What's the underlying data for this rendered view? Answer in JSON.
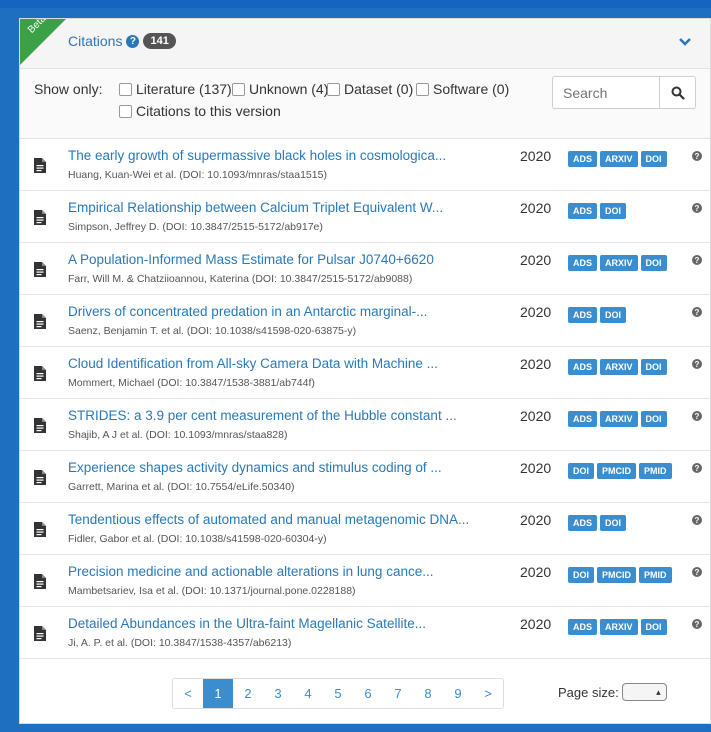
{
  "header": {
    "beta_label": "Beta",
    "title": "Citations",
    "help_icon": "question-circle-icon",
    "count": "141",
    "collapse_icon": "chevron-down-icon"
  },
  "filters": {
    "show_only_label": "Show only:",
    "options": [
      {
        "label": "Literature (137)",
        "checked": false
      },
      {
        "label": "Unknown (4)",
        "checked": false
      },
      {
        "label": "Dataset (0)",
        "checked": false
      },
      {
        "label": "Software (0)",
        "checked": false
      },
      {
        "label": "Citations to this version",
        "checked": false
      }
    ],
    "search_placeholder": "Search",
    "search_icon": "search-icon"
  },
  "rows": [
    {
      "title": "The early growth of supermassive black holes in cosmologica...",
      "subtitle": "Huang, Kuan-Wei et al. (DOI: 10.1093/mnras/staa1515)",
      "year": "2020",
      "badges": [
        "ADS",
        "ARXIV",
        "DOI"
      ]
    },
    {
      "title": "Empirical Relationship between Calcium Triplet Equivalent W...",
      "subtitle": "Simpson, Jeffrey D. (DOI: 10.3847/2515-5172/ab917e)",
      "year": "2020",
      "badges": [
        "ADS",
        "DOI"
      ]
    },
    {
      "title": "A Population-Informed Mass Estimate for Pulsar J0740+6620",
      "subtitle": "Farr, Will M. & Chatziioannou, Katerina (DOI: 10.3847/2515-5172/ab9088)",
      "year": "2020",
      "badges": [
        "ADS",
        "ARXIV",
        "DOI"
      ]
    },
    {
      "title": "Drivers of concentrated predation in an Antarctic marginal-...",
      "subtitle": "Saenz, Benjamin T. et al. (DOI: 10.1038/s41598-020-63875-y)",
      "year": "2020",
      "badges": [
        "ADS",
        "DOI"
      ]
    },
    {
      "title": "Cloud Identification from All-sky Camera Data with Machine ...",
      "subtitle": "Mommert, Michael (DOI: 10.3847/1538-3881/ab744f)",
      "year": "2020",
      "badges": [
        "ADS",
        "ARXIV",
        "DOI"
      ]
    },
    {
      "title": "STRIDES: a 3.9 per cent measurement of the Hubble constant ...",
      "subtitle": "Shajib, A J et al. (DOI: 10.1093/mnras/staa828)",
      "year": "2020",
      "badges": [
        "ADS",
        "ARXIV",
        "DOI"
      ]
    },
    {
      "title": "Experience shapes activity dynamics and stimulus coding of ...",
      "subtitle": "Garrett, Marina et al. (DOI: 10.7554/eLife.50340)",
      "year": "2020",
      "badges": [
        "DOI",
        "PMCID",
        "PMID"
      ]
    },
    {
      "title": "Tendentious effects of automated and manual metagenomic DNA...",
      "subtitle": "Fidler, Gabor et al. (DOI: 10.1038/s41598-020-60304-y)",
      "year": "2020",
      "badges": [
        "ADS",
        "DOI"
      ]
    },
    {
      "title": "Precision medicine and actionable alterations in lung cance...",
      "subtitle": "Mambetsariev, Isa et al. (DOI: 10.1371/journal.pone.0228188)",
      "year": "2020",
      "badges": [
        "DOI",
        "PMCID",
        "PMID"
      ]
    },
    {
      "title": "Detailed Abundances in the Ultra-faint Magellanic Satellite...",
      "subtitle": "Ji, A. P. et al. (DOI: 10.3847/1538-4357/ab6213)",
      "year": "2020",
      "badges": [
        "ADS",
        "ARXIV",
        "DOI"
      ]
    }
  ],
  "pagination": {
    "prev": "<",
    "pages": [
      "1",
      "2",
      "3",
      "4",
      "5",
      "6",
      "7",
      "8",
      "9"
    ],
    "current": "1",
    "next": ">",
    "page_size_label": "Page size:"
  },
  "colors": {
    "accent": "#3a8dcf",
    "link": "#2a78b8",
    "beta": "#3ca046",
    "background": "#1f6fc0"
  }
}
